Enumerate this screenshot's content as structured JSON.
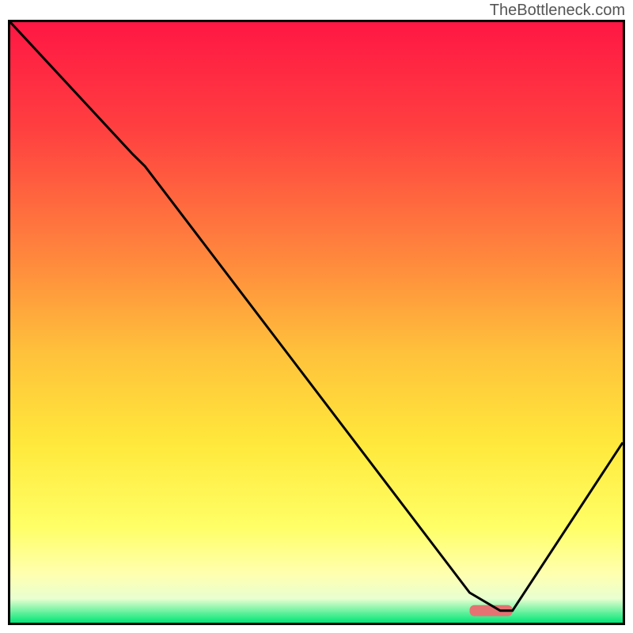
{
  "watermark": "TheBottleneck.com",
  "chart_data": {
    "type": "line",
    "title": "",
    "xlabel": "",
    "ylabel": "",
    "xlim": [
      0,
      100
    ],
    "ylim": [
      0,
      100
    ],
    "series": [
      {
        "name": "curve",
        "x": [
          0,
          20,
          22,
          75,
          80,
          82,
          100
        ],
        "values": [
          100,
          78,
          76,
          5,
          2,
          2,
          30
        ]
      }
    ],
    "marker": {
      "x_start": 75,
      "x_end": 82,
      "y": 2
    },
    "gradient_stops": [
      {
        "offset": 0,
        "color": "#ff1744"
      },
      {
        "offset": 0.18,
        "color": "#ff4040"
      },
      {
        "offset": 0.4,
        "color": "#ff8a3d"
      },
      {
        "offset": 0.55,
        "color": "#ffc13b"
      },
      {
        "offset": 0.7,
        "color": "#ffe83b"
      },
      {
        "offset": 0.84,
        "color": "#ffff66"
      },
      {
        "offset": 0.92,
        "color": "#ffffb0"
      },
      {
        "offset": 0.96,
        "color": "#e8ffd0"
      },
      {
        "offset": 1.0,
        "color": "#00e676"
      }
    ]
  }
}
